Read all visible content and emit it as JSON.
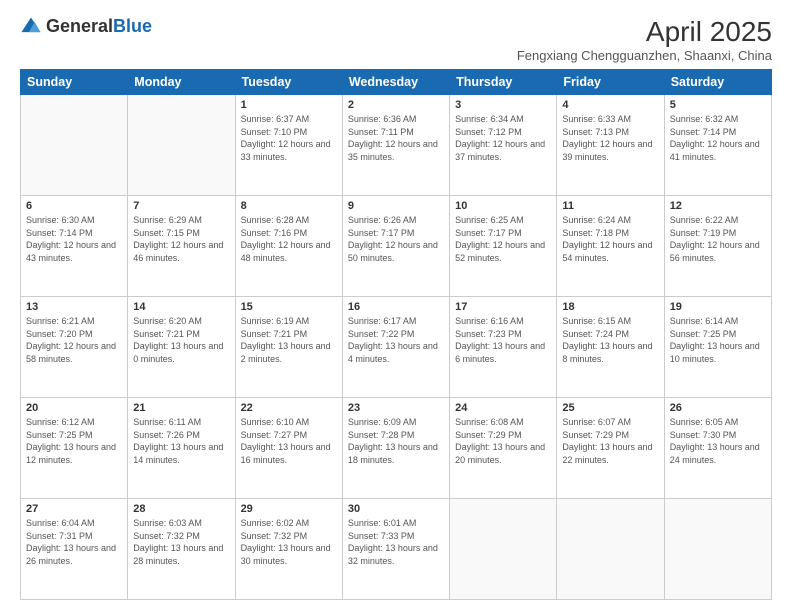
{
  "logo": {
    "general": "General",
    "blue": "Blue"
  },
  "header": {
    "title": "April 2025",
    "subtitle": "Fengxiang Chengguanzhen, Shaanxi, China"
  },
  "weekdays": [
    "Sunday",
    "Monday",
    "Tuesday",
    "Wednesday",
    "Thursday",
    "Friday",
    "Saturday"
  ],
  "weeks": [
    [
      {
        "day": "",
        "info": ""
      },
      {
        "day": "",
        "info": ""
      },
      {
        "day": "1",
        "info": "Sunrise: 6:37 AM\nSunset: 7:10 PM\nDaylight: 12 hours and 33 minutes."
      },
      {
        "day": "2",
        "info": "Sunrise: 6:36 AM\nSunset: 7:11 PM\nDaylight: 12 hours and 35 minutes."
      },
      {
        "day": "3",
        "info": "Sunrise: 6:34 AM\nSunset: 7:12 PM\nDaylight: 12 hours and 37 minutes."
      },
      {
        "day": "4",
        "info": "Sunrise: 6:33 AM\nSunset: 7:13 PM\nDaylight: 12 hours and 39 minutes."
      },
      {
        "day": "5",
        "info": "Sunrise: 6:32 AM\nSunset: 7:14 PM\nDaylight: 12 hours and 41 minutes."
      }
    ],
    [
      {
        "day": "6",
        "info": "Sunrise: 6:30 AM\nSunset: 7:14 PM\nDaylight: 12 hours and 43 minutes."
      },
      {
        "day": "7",
        "info": "Sunrise: 6:29 AM\nSunset: 7:15 PM\nDaylight: 12 hours and 46 minutes."
      },
      {
        "day": "8",
        "info": "Sunrise: 6:28 AM\nSunset: 7:16 PM\nDaylight: 12 hours and 48 minutes."
      },
      {
        "day": "9",
        "info": "Sunrise: 6:26 AM\nSunset: 7:17 PM\nDaylight: 12 hours and 50 minutes."
      },
      {
        "day": "10",
        "info": "Sunrise: 6:25 AM\nSunset: 7:17 PM\nDaylight: 12 hours and 52 minutes."
      },
      {
        "day": "11",
        "info": "Sunrise: 6:24 AM\nSunset: 7:18 PM\nDaylight: 12 hours and 54 minutes."
      },
      {
        "day": "12",
        "info": "Sunrise: 6:22 AM\nSunset: 7:19 PM\nDaylight: 12 hours and 56 minutes."
      }
    ],
    [
      {
        "day": "13",
        "info": "Sunrise: 6:21 AM\nSunset: 7:20 PM\nDaylight: 12 hours and 58 minutes."
      },
      {
        "day": "14",
        "info": "Sunrise: 6:20 AM\nSunset: 7:21 PM\nDaylight: 13 hours and 0 minutes."
      },
      {
        "day": "15",
        "info": "Sunrise: 6:19 AM\nSunset: 7:21 PM\nDaylight: 13 hours and 2 minutes."
      },
      {
        "day": "16",
        "info": "Sunrise: 6:17 AM\nSunset: 7:22 PM\nDaylight: 13 hours and 4 minutes."
      },
      {
        "day": "17",
        "info": "Sunrise: 6:16 AM\nSunset: 7:23 PM\nDaylight: 13 hours and 6 minutes."
      },
      {
        "day": "18",
        "info": "Sunrise: 6:15 AM\nSunset: 7:24 PM\nDaylight: 13 hours and 8 minutes."
      },
      {
        "day": "19",
        "info": "Sunrise: 6:14 AM\nSunset: 7:25 PM\nDaylight: 13 hours and 10 minutes."
      }
    ],
    [
      {
        "day": "20",
        "info": "Sunrise: 6:12 AM\nSunset: 7:25 PM\nDaylight: 13 hours and 12 minutes."
      },
      {
        "day": "21",
        "info": "Sunrise: 6:11 AM\nSunset: 7:26 PM\nDaylight: 13 hours and 14 minutes."
      },
      {
        "day": "22",
        "info": "Sunrise: 6:10 AM\nSunset: 7:27 PM\nDaylight: 13 hours and 16 minutes."
      },
      {
        "day": "23",
        "info": "Sunrise: 6:09 AM\nSunset: 7:28 PM\nDaylight: 13 hours and 18 minutes."
      },
      {
        "day": "24",
        "info": "Sunrise: 6:08 AM\nSunset: 7:29 PM\nDaylight: 13 hours and 20 minutes."
      },
      {
        "day": "25",
        "info": "Sunrise: 6:07 AM\nSunset: 7:29 PM\nDaylight: 13 hours and 22 minutes."
      },
      {
        "day": "26",
        "info": "Sunrise: 6:05 AM\nSunset: 7:30 PM\nDaylight: 13 hours and 24 minutes."
      }
    ],
    [
      {
        "day": "27",
        "info": "Sunrise: 6:04 AM\nSunset: 7:31 PM\nDaylight: 13 hours and 26 minutes."
      },
      {
        "day": "28",
        "info": "Sunrise: 6:03 AM\nSunset: 7:32 PM\nDaylight: 13 hours and 28 minutes."
      },
      {
        "day": "29",
        "info": "Sunrise: 6:02 AM\nSunset: 7:32 PM\nDaylight: 13 hours and 30 minutes."
      },
      {
        "day": "30",
        "info": "Sunrise: 6:01 AM\nSunset: 7:33 PM\nDaylight: 13 hours and 32 minutes."
      },
      {
        "day": "",
        "info": ""
      },
      {
        "day": "",
        "info": ""
      },
      {
        "day": "",
        "info": ""
      }
    ]
  ]
}
